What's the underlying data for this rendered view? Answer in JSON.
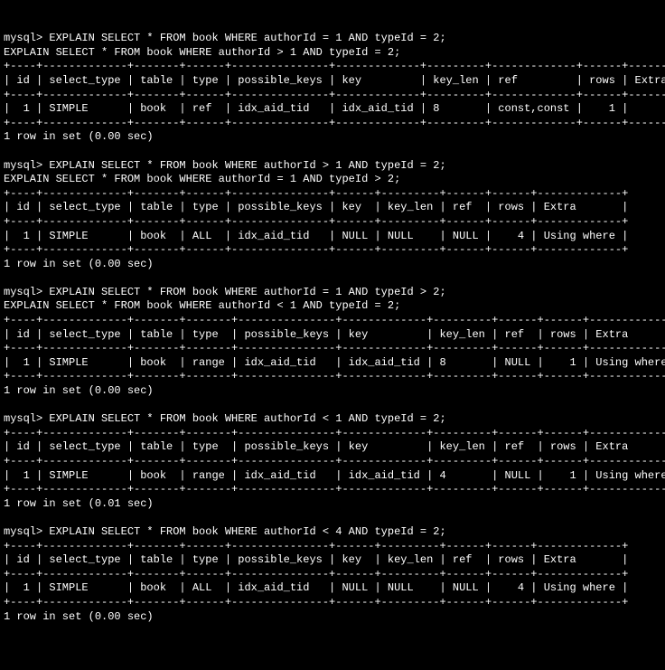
{
  "queries": [
    {
      "prompt": "mysql> EXPLAIN SELECT * FROM book WHERE authorId = 1 AND typeId = 2;",
      "echo": "EXPLAIN SELECT * FROM book WHERE authorId > 1 AND typeId = 2;",
      "cols": [
        "id",
        "select_type",
        "table",
        "type",
        "possible_keys",
        "key",
        "key_len",
        "ref",
        "rows",
        "Extra"
      ],
      "widths": [
        2,
        11,
        5,
        4,
        13,
        11,
        7,
        11,
        4,
        5
      ],
      "row": [
        "1",
        "SIMPLE",
        "book",
        "ref",
        "idx_aid_tid",
        "idx_aid_tid",
        "8",
        "const,const",
        "1",
        ""
      ],
      "align": [
        "r",
        "l",
        "l",
        "l",
        "l",
        "l",
        "l",
        "l",
        "r",
        "l"
      ],
      "timing": "1 row in set (0.00 sec)"
    },
    {
      "prompt": "mysql> EXPLAIN SELECT * FROM book WHERE authorId > 1 AND typeId = 2;",
      "echo": "EXPLAIN SELECT * FROM book WHERE authorId = 1 AND typeId > 2;",
      "cols": [
        "id",
        "select_type",
        "table",
        "type",
        "possible_keys",
        "key",
        "key_len",
        "ref",
        "rows",
        "Extra"
      ],
      "widths": [
        2,
        11,
        5,
        4,
        13,
        4,
        7,
        4,
        4,
        11
      ],
      "row": [
        "1",
        "SIMPLE",
        "book",
        "ALL",
        "idx_aid_tid",
        "NULL",
        "NULL",
        "NULL",
        "4",
        "Using where"
      ],
      "align": [
        "r",
        "l",
        "l",
        "l",
        "l",
        "l",
        "l",
        "l",
        "r",
        "l"
      ],
      "timing": "1 row in set (0.00 sec)"
    },
    {
      "prompt": "mysql> EXPLAIN SELECT * FROM book WHERE authorId = 1 AND typeId > 2;",
      "echo": "EXPLAIN SELECT * FROM book WHERE authorId < 1 AND typeId = 2;",
      "cols": [
        "id",
        "select_type",
        "table",
        "type",
        "possible_keys",
        "key",
        "key_len",
        "ref",
        "rows",
        "Extra"
      ],
      "widths": [
        2,
        11,
        5,
        5,
        13,
        11,
        7,
        4,
        4,
        11
      ],
      "row": [
        "1",
        "SIMPLE",
        "book",
        "range",
        "idx_aid_tid",
        "idx_aid_tid",
        "8",
        "NULL",
        "1",
        "Using where"
      ],
      "align": [
        "r",
        "l",
        "l",
        "l",
        "l",
        "l",
        "l",
        "l",
        "r",
        "l"
      ],
      "timing": "1 row in set (0.00 sec)"
    },
    {
      "prompt": "mysql> EXPLAIN SELECT * FROM book WHERE authorId < 1 AND typeId = 2;",
      "echo": "",
      "cols": [
        "id",
        "select_type",
        "table",
        "type",
        "possible_keys",
        "key",
        "key_len",
        "ref",
        "rows",
        "Extra"
      ],
      "widths": [
        2,
        11,
        5,
        5,
        13,
        11,
        7,
        4,
        4,
        11
      ],
      "row": [
        "1",
        "SIMPLE",
        "book",
        "range",
        "idx_aid_tid",
        "idx_aid_tid",
        "4",
        "NULL",
        "1",
        "Using where"
      ],
      "align": [
        "r",
        "l",
        "l",
        "l",
        "l",
        "l",
        "l",
        "l",
        "r",
        "l"
      ],
      "timing": "1 row in set (0.01 sec)"
    },
    {
      "prompt": "mysql> EXPLAIN SELECT * FROM book WHERE authorId < 4 AND typeId = 2;",
      "echo": "",
      "cols": [
        "id",
        "select_type",
        "table",
        "type",
        "possible_keys",
        "key",
        "key_len",
        "ref",
        "rows",
        "Extra"
      ],
      "widths": [
        2,
        11,
        5,
        4,
        13,
        4,
        7,
        4,
        4,
        11
      ],
      "row": [
        "1",
        "SIMPLE",
        "book",
        "ALL",
        "idx_aid_tid",
        "NULL",
        "NULL",
        "NULL",
        "4",
        "Using where"
      ],
      "align": [
        "r",
        "l",
        "l",
        "l",
        "l",
        "l",
        "l",
        "l",
        "r",
        "l"
      ],
      "timing": "1 row in set (0.00 sec)"
    }
  ]
}
